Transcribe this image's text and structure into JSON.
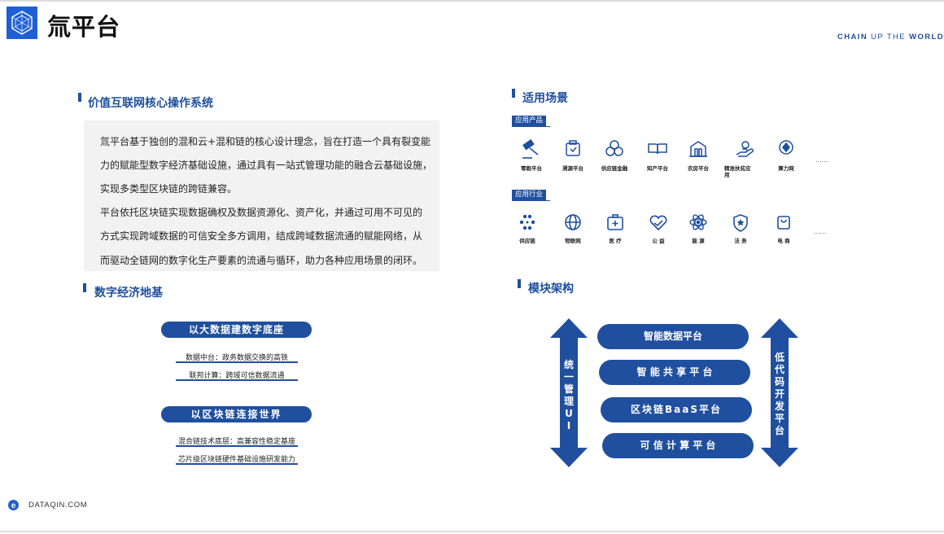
{
  "header": {
    "brand_title": "氚平台",
    "tagline_part1": "CHAIN",
    "tagline_part2": "UP THE",
    "tagline_part3": "WORLD",
    "logo_icon": "hex-network-icon",
    "brand_color": "#1f5fd6"
  },
  "footer": {
    "site": "DATAQIN.COM",
    "logo_icon": "e-logo-icon"
  },
  "section_os": {
    "title": "价值互联网核心操作系统",
    "lines": [
      "氚平台基于独创的混和云+混和链的核心设计理念，旨在打造一个具有裂变能",
      "力的赋能型数字经济基础设施，通过具有一站式管理功能的融合云基础设施，",
      "实现多类型区块链的跨链兼容。",
      "平台依托区块链实现数据确权及数据资源化、资产化，并通过可用不可见的",
      "方式实现跨域数据的可信安全多方调用，结成跨域数据流通的赋能网络，从",
      "而驱动全链网的数字化生产要素的流通与循环，助力各种应用场景的闭环。"
    ]
  },
  "section_base": {
    "title": "数字经济地基",
    "pill1": "以大数据建数字底座",
    "pill1_items": [
      "数据中台：政务数据交换的高铁",
      "联邦计算：跨域可信数据流通"
    ],
    "pill2": "以区块链连接世界",
    "pill2_items": [
      "混合链技术底层：高兼容性稳定基座",
      "芯片级区块链硬件基础设施研发能力"
    ]
  },
  "section_scenes": {
    "title": "适用场景",
    "products_tag": "应用产品",
    "products": [
      {
        "label": "零跑平台",
        "icon": "gavel-icon"
      },
      {
        "label": "溯源平台",
        "icon": "trace-box-icon"
      },
      {
        "label": "供应链金融",
        "icon": "coins-icon"
      },
      {
        "label": "知产平台",
        "icon": "open-book-icon"
      },
      {
        "label": "农房平台",
        "icon": "farmhouse-icon"
      },
      {
        "label": "精准扶贫应用",
        "icon": "helping-hand-icon"
      },
      {
        "label": "算力网",
        "icon": "compute-chip-icon"
      }
    ],
    "industries_tag": "应用行业",
    "industries": [
      {
        "label": "供应链",
        "icon": "nodes-icon"
      },
      {
        "label": "物联网",
        "icon": "globe-icon"
      },
      {
        "label": "医 疗",
        "icon": "medical-kit-icon"
      },
      {
        "label": "公 益",
        "icon": "heart-hands-icon"
      },
      {
        "label": "能 源",
        "icon": "atom-icon"
      },
      {
        "label": "法 务",
        "icon": "shield-star-icon"
      },
      {
        "label": "电 商",
        "icon": "shopping-bag-icon"
      }
    ],
    "more": "......"
  },
  "section_modules": {
    "title": "模块架构",
    "modules": [
      "智能数据平台",
      "智 能 共 享 平 台",
      "区块链BaaS平台",
      "可 信 计 算 平 台"
    ],
    "left_arrow": [
      "统",
      "一",
      "管",
      "理",
      "U",
      "I"
    ],
    "right_arrow": [
      "低",
      "代",
      "码",
      "开",
      "发",
      "平",
      "台"
    ]
  }
}
